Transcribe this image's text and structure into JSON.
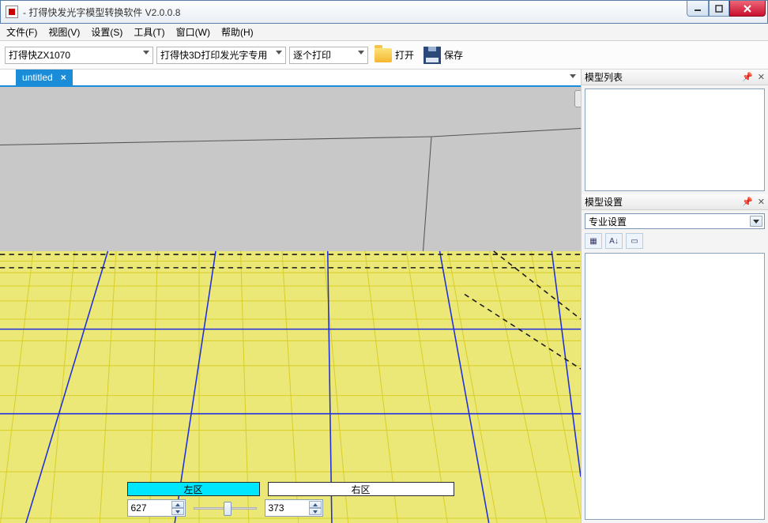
{
  "window": {
    "title": " - 打得快发光字模型转换软件 V2.0.0.8"
  },
  "menu": {
    "file": "文件(F)",
    "view": "视图(V)",
    "settings": "设置(S)",
    "tools": "工具(T)",
    "window": "窗口(W)",
    "help": "帮助(H)"
  },
  "toolbar": {
    "printer": "打得快ZX1070",
    "profile": "打得快3D打印发光字专用",
    "mode": "逐个打印",
    "open": "打开",
    "save": "保存"
  },
  "tab": {
    "name": "untitled"
  },
  "zones": {
    "left_label": "左区",
    "right_label": "右区",
    "left_value": "627",
    "right_value": "373"
  },
  "panels": {
    "model_list": "模型列表",
    "model_settings": "模型设置",
    "pro_settings": "专业设置"
  }
}
